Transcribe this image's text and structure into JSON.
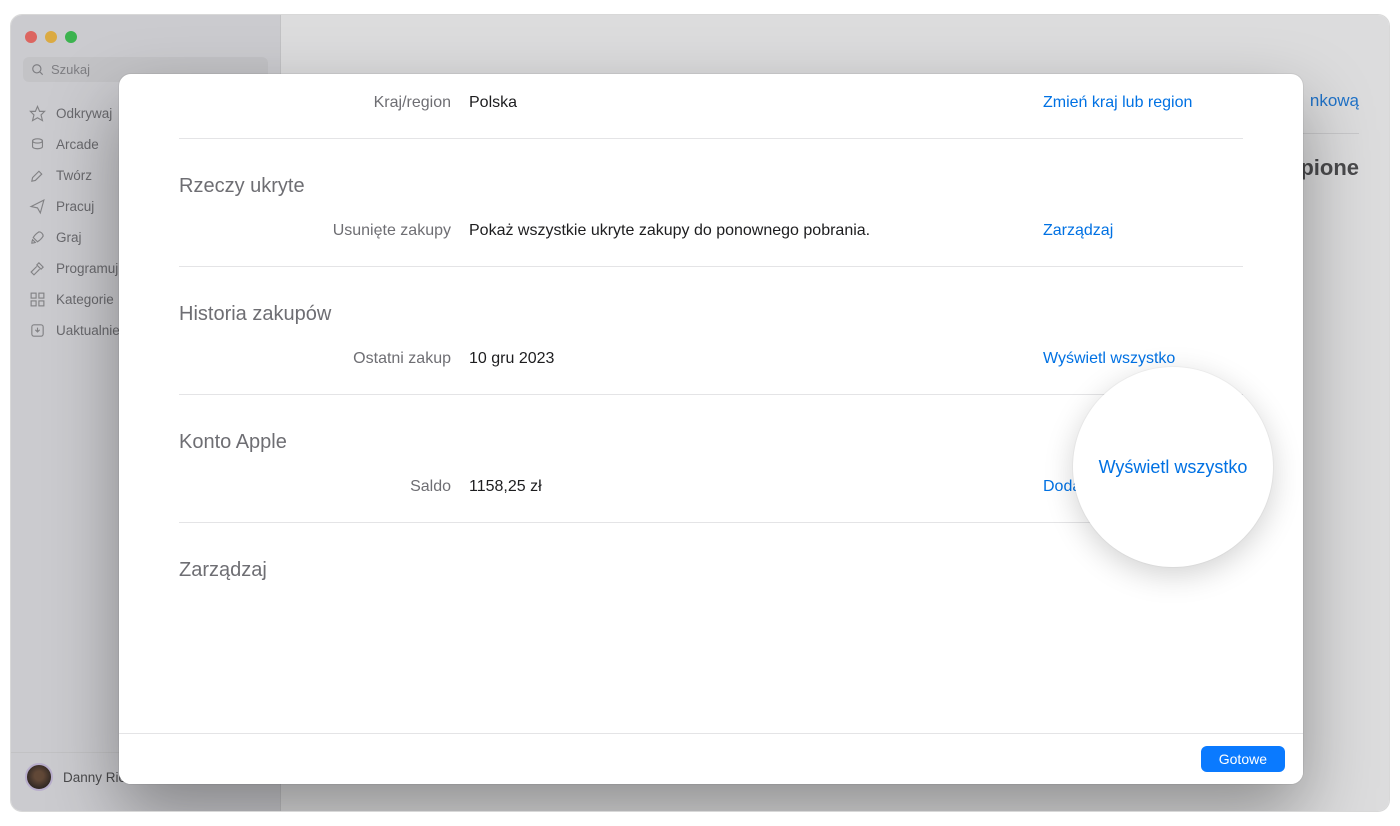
{
  "sidebar": {
    "search_placeholder": "Szukaj",
    "items": [
      {
        "label": "Odkrywaj"
      },
      {
        "label": "Arcade"
      },
      {
        "label": "Twórz"
      },
      {
        "label": "Pracuj"
      },
      {
        "label": "Graj"
      },
      {
        "label": "Programuj"
      },
      {
        "label": "Kategorie"
      },
      {
        "label": "Uaktualnienia"
      }
    ],
    "user_name": "Danny Rico"
  },
  "background": {
    "link_text": "nkową",
    "heading": "pione"
  },
  "modal": {
    "country": {
      "label": "Kraj/region",
      "value": "Polska",
      "action": "Zmień kraj lub region"
    },
    "hidden": {
      "title": "Rzeczy ukryte",
      "label": "Usunięte zakupy",
      "value": "Pokaż wszystkie ukryte zakupy do ponownego pobrania.",
      "action": "Zarządzaj"
    },
    "history": {
      "title": "Historia zakupów",
      "label": "Ostatni zakup",
      "value": "10 gru 2023",
      "action": "Wyświetl wszystko"
    },
    "account": {
      "title": "Konto Apple",
      "label": "Saldo",
      "value": "1158,25 zł",
      "action": "Dodaj środki"
    },
    "manage": {
      "title": "Zarządzaj"
    },
    "done_button": "Gotowe"
  },
  "callout_text": "Wyświetl wszystko"
}
